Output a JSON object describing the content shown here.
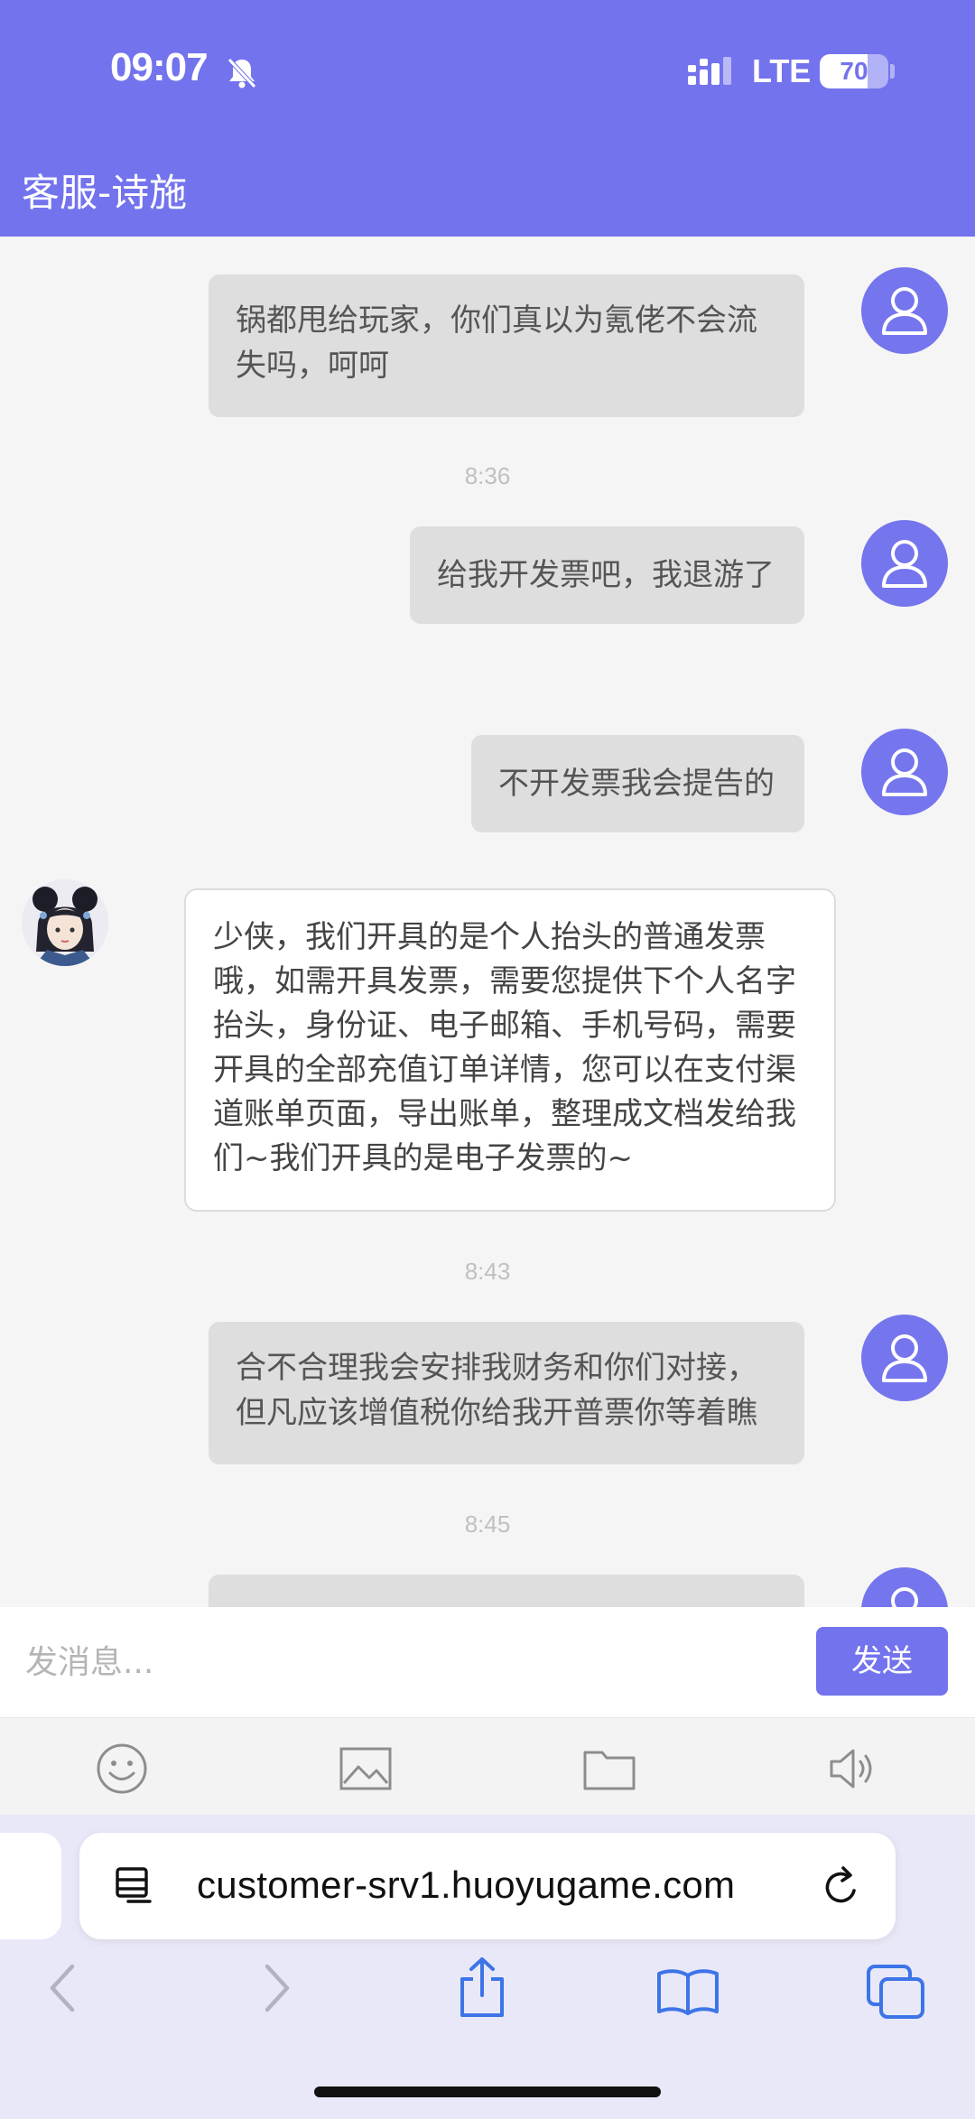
{
  "status_bar": {
    "time": "09:07",
    "network": "LTE",
    "battery_percent": 70,
    "battery_text": "70"
  },
  "header": {
    "title": "客服-诗施"
  },
  "messages": [
    {
      "sender": "user",
      "text": "锅都甩给玩家，你们真以为氪佬不会流失吗，呵呵"
    },
    {
      "type": "timestamp",
      "text": "8:36"
    },
    {
      "sender": "user",
      "text": "给我开发票吧，我退游了"
    },
    {
      "sender": "user",
      "text": "不开发票我会提告的"
    },
    {
      "sender": "agent",
      "text": "少侠，我们开具的是个人抬头的普通发票哦，如需开具发票，需要您提供下个人名字抬头，身份证、电子邮箱、手机号码，需要开具的全部充值订单详情，您可以在支付渠道账单页面，导出账单，整理成文档发给我们~我们开具的是电子发票的~"
    },
    {
      "type": "timestamp",
      "text": "8:43"
    },
    {
      "sender": "user",
      "text": "合不合理我会安排我财务和你们对接，但凡应该增值税你给我开普票你等着瞧"
    },
    {
      "type": "timestamp",
      "text": "8:45"
    },
    {
      "sender": "user",
      "text": ""
    }
  ],
  "input": {
    "placeholder": "发消息...",
    "send_label": "发送"
  },
  "toolbar": {
    "icons": [
      "emoji-icon",
      "image-icon",
      "folder-icon",
      "speaker-icon"
    ]
  },
  "browser": {
    "url": "customer-srv1.huoyugame.com"
  },
  "colors": {
    "accent": "#7373ee",
    "user_bubble": "#dedede",
    "agent_bubble": "#ffffff"
  }
}
